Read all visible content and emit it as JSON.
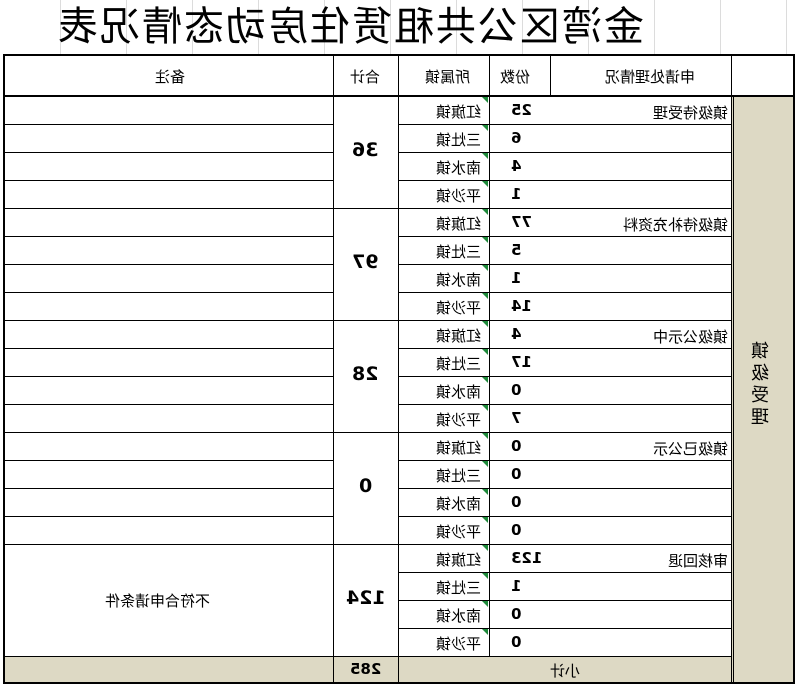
{
  "title": "金湾区公共租赁住房动态情况表",
  "header": {
    "remarks": "备注",
    "total": "合计",
    "town": "所属镇",
    "count": "份数",
    "status": "申请处理情况"
  },
  "side_label": "镇级受理",
  "groups": [
    {
      "status": "镇级待受理",
      "total": "36",
      "remark": "",
      "rows": [
        {
          "town": "红旗镇",
          "count": "25"
        },
        {
          "town": "三灶镇",
          "count": "6"
        },
        {
          "town": "南水镇",
          "count": "4"
        },
        {
          "town": "平沙镇",
          "count": "1"
        }
      ]
    },
    {
      "status": "镇级待补充资料",
      "total": "97",
      "remark": "",
      "rows": [
        {
          "town": "红旗镇",
          "count": "77"
        },
        {
          "town": "三灶镇",
          "count": "5"
        },
        {
          "town": "南水镇",
          "count": "1"
        },
        {
          "town": "平沙镇",
          "count": "14"
        }
      ]
    },
    {
      "status": "镇级公示中",
      "total": "28",
      "remark": "",
      "rows": [
        {
          "town": "红旗镇",
          "count": "4"
        },
        {
          "town": "三灶镇",
          "count": "17"
        },
        {
          "town": "南水镇",
          "count": "0"
        },
        {
          "town": "平沙镇",
          "count": "7"
        }
      ]
    },
    {
      "status": "镇级已公示",
      "total": "0",
      "remark": "",
      "rows": [
        {
          "town": "红旗镇",
          "count": "0"
        },
        {
          "town": "三灶镇",
          "count": "0"
        },
        {
          "town": "南水镇",
          "count": "0"
        },
        {
          "town": "平沙镇",
          "count": "0"
        }
      ]
    },
    {
      "status": "审核回退",
      "total": "124",
      "remark": "不符合申请条件",
      "rows": [
        {
          "town": "红旗镇",
          "count": "123"
        },
        {
          "town": "三灶镇",
          "count": "1"
        },
        {
          "town": "南水镇",
          "count": "0"
        },
        {
          "town": "平沙镇",
          "count": "0"
        }
      ]
    }
  ],
  "subtotal": {
    "label": "小计",
    "value": "285"
  },
  "colors": {
    "side_fill": "#ddd9c4",
    "marker": "#1f8a3b"
  }
}
